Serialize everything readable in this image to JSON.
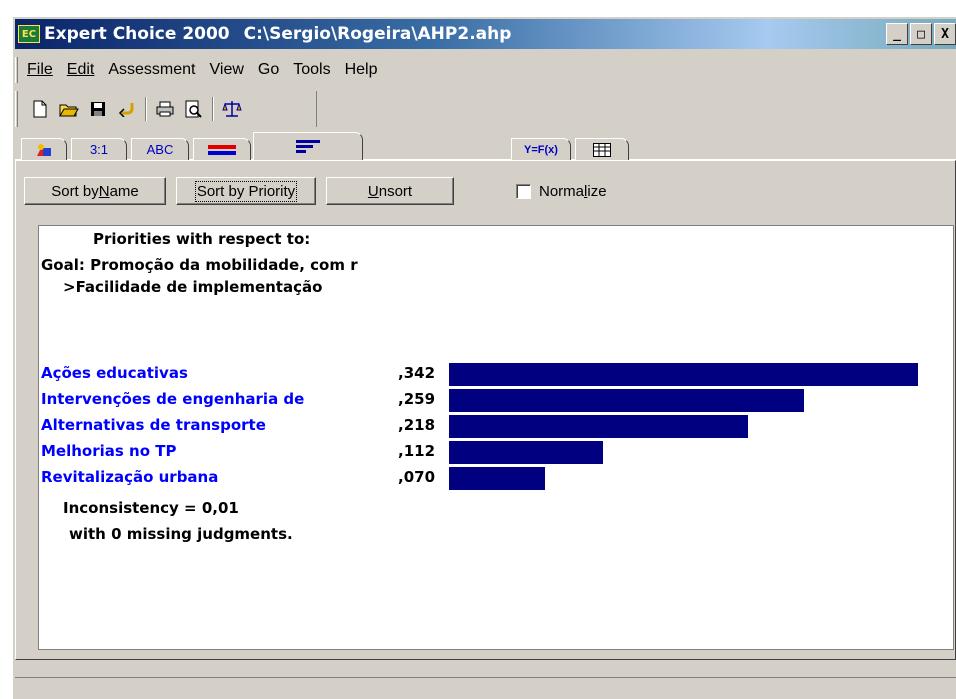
{
  "window": {
    "app_name": "Expert Choice 2000",
    "file_path": "C:\\Sergio\\Rogeira\\AHP2.ahp",
    "icon_text": "EC",
    "controls": {
      "minimize": "_",
      "maximize": "□",
      "close": "X"
    }
  },
  "menu": [
    "File",
    "Edit",
    "Assessment",
    "View",
    "Go",
    "Tools",
    "Help"
  ],
  "toolbar": {
    "icons": [
      "new-file-icon",
      "open-folder-icon",
      "save-icon",
      "undo-icon",
      "print-icon",
      "print-preview-icon",
      "balance-scale-icon"
    ]
  },
  "tabs": {
    "items": [
      {
        "name": "model-tab",
        "label": ""
      },
      {
        "name": "pairwise-numeric-tab",
        "label": "3:1"
      },
      {
        "name": "verbal-tab",
        "label": "ABC"
      },
      {
        "name": "graphical-tab",
        "label": ""
      },
      {
        "name": "priorities-tab",
        "label": ""
      },
      {
        "name": "formula-tab",
        "label": "Y=F(x)"
      },
      {
        "name": "data-grid-tab",
        "label": ""
      }
    ],
    "active": "priorities-tab"
  },
  "sort_buttons": {
    "by_name": {
      "pre": "Sort by ",
      "ul": "N",
      "post": "ame"
    },
    "by_priority": "Sort by Priority",
    "unsort": {
      "ul": "U",
      "post": "nsort"
    }
  },
  "normalize": {
    "pre": "Norma",
    "ul": "l",
    "post": "ize",
    "checked": false
  },
  "priorities": {
    "heading": "Priorities with respect to:",
    "goal": "Goal: Promoção da mobilidade, com r",
    "node": ">Facilidade de implementação",
    "items": [
      {
        "label": "Ações educativas",
        "value_text": ",342",
        "value": 0.342
      },
      {
        "label": "Intervenções de engenharia de",
        "value_text": ",259",
        "value": 0.259
      },
      {
        "label": "Alternativas de transporte",
        "value_text": ",218",
        "value": 0.218
      },
      {
        "label": "Melhorias no TP",
        "value_text": ",112",
        "value": 0.112
      },
      {
        "label": "Revitalização urbana",
        "value_text": ",070",
        "value": 0.07
      }
    ],
    "inconsistency": "Inconsistency = 0,01",
    "missing": "with 0  missing judgments."
  },
  "colors": {
    "bar": "#000080",
    "label": "#0000ff",
    "title_start": "#0a246a"
  }
}
